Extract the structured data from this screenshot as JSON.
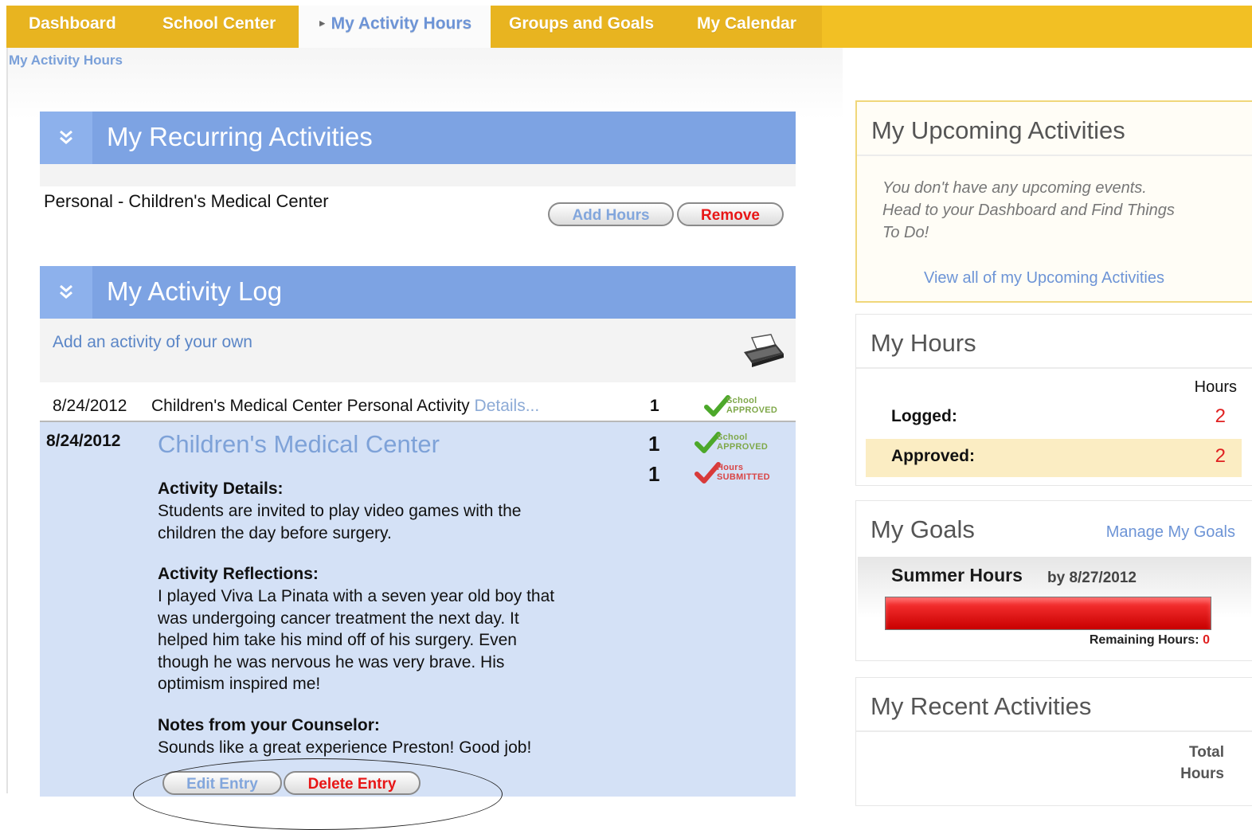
{
  "nav": {
    "tabs": [
      "Dashboard",
      "School Center",
      "My Activity Hours",
      "Groups and Goals",
      "My Calendar"
    ],
    "active": "My Activity Hours"
  },
  "breadcrumb": "My Activity Hours",
  "recurring": {
    "title": "My Recurring Activities",
    "item": "Personal - Children's Medical Center",
    "add_hours_label": "Add Hours",
    "remove_label": "Remove"
  },
  "log": {
    "title": "My Activity Log",
    "add_link": "Add an activity of your own",
    "row": {
      "date": "8/24/2012",
      "desc": "Children's Medical Center Personal Activity",
      "details_link": "Details...",
      "hours": "1",
      "stamp": [
        "School",
        "APPROVED"
      ]
    },
    "expanded": {
      "date": "8/24/2012",
      "name": "Children's Medical Center",
      "hours_approved": "1",
      "hours_submitted": "1",
      "stamp_approved": [
        "School",
        "APPROVED"
      ],
      "stamp_submitted": [
        "Hours",
        "SUBMITTED"
      ],
      "details_label": "Activity Details:",
      "details_lines": [
        "Students are invited to play video games with the",
        "children the day before surgery."
      ],
      "reflections_label": "Activity Reflections:",
      "reflections_lines": [
        "I played Viva La Pinata with a seven year old boy that",
        "was undergoing cancer treatment the next day. It",
        "helped him take his mind off of his surgery. Even",
        "though he was nervous he was very brave. His",
        "optimism inspired me!"
      ],
      "notes_label": "Notes from your Counselor:",
      "notes_text": "Sounds like a great experience Preston! Good job!",
      "edit_label": "Edit Entry",
      "delete_label": "Delete Entry"
    }
  },
  "upcoming": {
    "title": "My Upcoming Activities",
    "message_lines": [
      "You don't have any upcoming events.",
      "Head to your Dashboard and Find Things",
      "To Do!"
    ],
    "view_link": "View all of my Upcoming Activities"
  },
  "my_hours": {
    "title": "My Hours",
    "column_header": "Hours",
    "logged_label": "Logged:",
    "logged_value": "2",
    "approved_label": "Approved:",
    "approved_value": "2"
  },
  "goals": {
    "title": "My Goals",
    "manage_link": "Manage My Goals",
    "goal_name": "Summer Hours",
    "goal_by": "by 8/27/2012",
    "progress_fraction": 1.0,
    "remaining_label": "Remaining Hours:",
    "remaining_value": "0"
  },
  "recent": {
    "title": "My Recent Activities",
    "col_line1": "Total",
    "col_line2": "Hours"
  },
  "colors": {
    "nav_bg": "#e8b420",
    "section_header": "#7da3e3",
    "link": "#5b86c7",
    "alert_red": "#e02020",
    "expanded_bg": "#d4e1f6"
  }
}
